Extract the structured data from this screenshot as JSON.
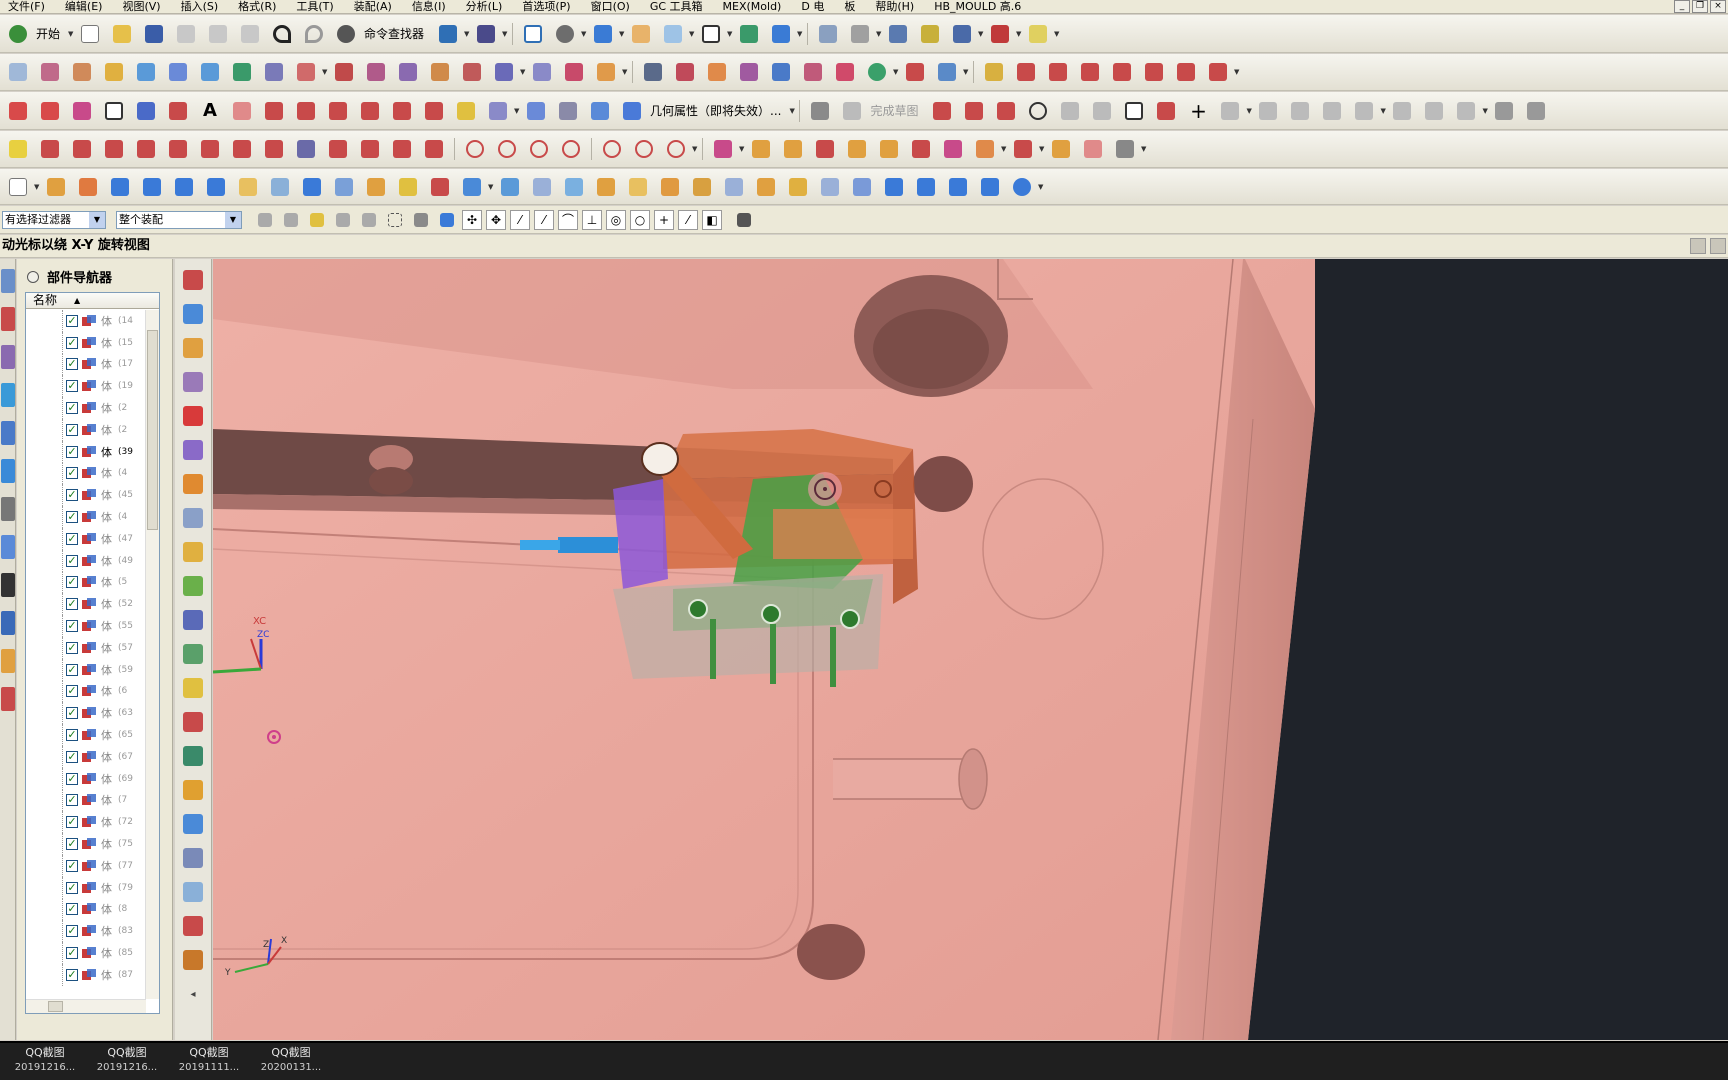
{
  "menu": [
    "文件(F)",
    "编辑(E)",
    "视图(V)",
    "插入(S)",
    "格式(R)",
    "工具(T)",
    "装配(A)",
    "信息(I)",
    "分析(L)",
    "首选项(P)",
    "窗口(O)",
    "GC 工具箱",
    "MEX(Mold)",
    "D 电",
    "板",
    "帮助(H)",
    "HB_MOULD 高.6"
  ],
  "toolbar": {
    "start_label": "开始",
    "command_finder_label": "命令查找器",
    "geometry_properties_label": "几何属性（即将失效）...",
    "finish_sketch_label": "完成草图"
  },
  "selection_bar": {
    "filter_value": "有选择过滤器",
    "scope_value": "整个装配"
  },
  "cue_line": "动光标以绕 X-Y 旋转视图",
  "navigator": {
    "title": "部件导航器",
    "column_header": "名称",
    "rows": [
      {
        "label": "体",
        "num": "(14"
      },
      {
        "label": "体",
        "num": "(15"
      },
      {
        "label": "体",
        "num": "(17"
      },
      {
        "label": "体",
        "num": "(19"
      },
      {
        "label": "体",
        "num": "(2"
      },
      {
        "label": "体",
        "num": "(2"
      },
      {
        "label": "体",
        "num": "(39",
        "selected": true
      },
      {
        "label": "体",
        "num": "(4"
      },
      {
        "label": "体",
        "num": "(45"
      },
      {
        "label": "体",
        "num": "(4"
      },
      {
        "label": "体",
        "num": "(47"
      },
      {
        "label": "体",
        "num": "(49"
      },
      {
        "label": "体",
        "num": "(5"
      },
      {
        "label": "体",
        "num": "(52"
      },
      {
        "label": "体",
        "num": "(55"
      },
      {
        "label": "体",
        "num": "(57"
      },
      {
        "label": "体",
        "num": "(59"
      },
      {
        "label": "体",
        "num": "(6"
      },
      {
        "label": "体",
        "num": "(63"
      },
      {
        "label": "体",
        "num": "(65"
      },
      {
        "label": "体",
        "num": "(67"
      },
      {
        "label": "体",
        "num": "(69"
      },
      {
        "label": "体",
        "num": "(7"
      },
      {
        "label": "体",
        "num": "(72"
      },
      {
        "label": "体",
        "num": "(75"
      },
      {
        "label": "体",
        "num": "(77"
      },
      {
        "label": "体",
        "num": "(79"
      },
      {
        "label": "体",
        "num": "(8"
      },
      {
        "label": "体",
        "num": "(83"
      },
      {
        "label": "体",
        "num": "(85"
      },
      {
        "label": "体",
        "num": "(87"
      }
    ]
  },
  "viewport": {
    "triad_labels": {
      "xc": "XC",
      "zc": "ZC",
      "x": "X",
      "y": "Y",
      "z": "Z"
    }
  },
  "taskbar": [
    {
      "title": "QQ截图",
      "sub": "20191216..."
    },
    {
      "title": "QQ截图",
      "sub": "20191216..."
    },
    {
      "title": "QQ截图",
      "sub": "20191111..."
    },
    {
      "title": "QQ截图",
      "sub": "20200131..."
    }
  ],
  "colors": {
    "mold_base": "#e8a79f",
    "slider_orange": "#d9704a",
    "slider_green": "#4aa24a",
    "slider_purple": "#8a5ad8",
    "background": "#1f232a"
  }
}
